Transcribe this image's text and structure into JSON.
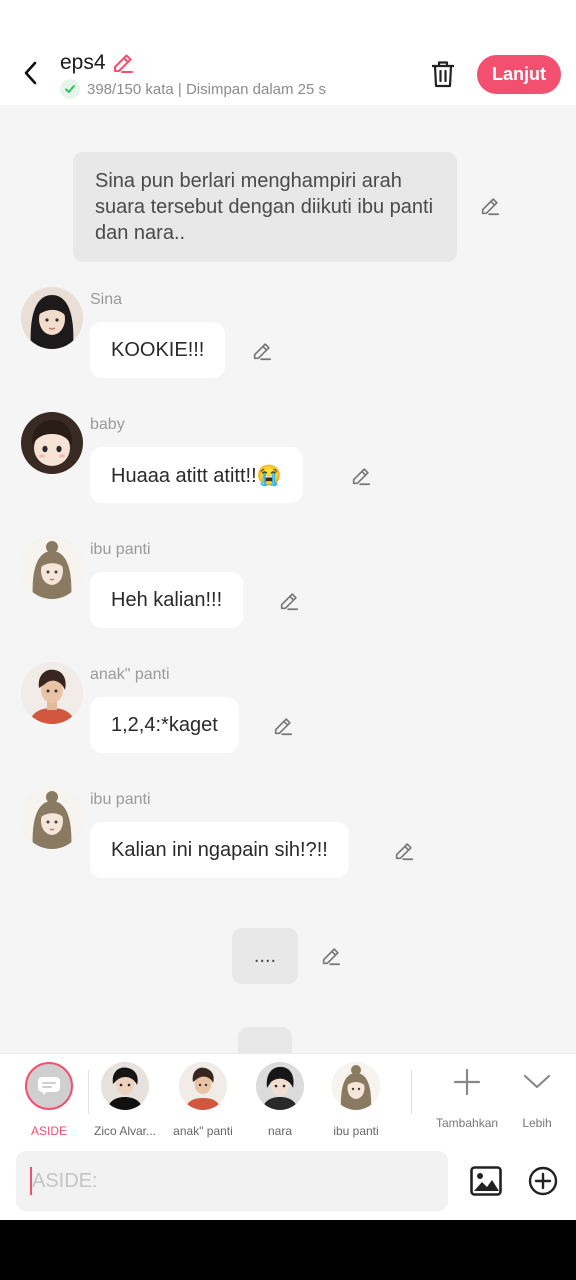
{
  "header": {
    "title": "eps4",
    "status": "398/150 kata | Disimpan dalam 25 s",
    "next_label": "Lanjut"
  },
  "chat": {
    "narration": "Sina pun berlari menghampiri arah suara tersebut dengan diikuti ibu panti dan nara..",
    "messages": [
      {
        "sender": "Sina",
        "text": "KOOKIE!!!"
      },
      {
        "sender": "baby",
        "text": "Huaaa atitt atitt!!😭"
      },
      {
        "sender": "ibu panti",
        "text": "Heh kalian!!!"
      },
      {
        "sender": "anak\" panti",
        "text": "1,2,4:*kaget"
      },
      {
        "sender": "ibu panti",
        "text": "Kalian ini ngapain sih!?!!"
      }
    ],
    "aside_text": "...."
  },
  "characters": [
    {
      "label": "ASIDE"
    },
    {
      "label": "Zico Alvar..."
    },
    {
      "label": "anak\" panti"
    },
    {
      "label": "nara"
    },
    {
      "label": "ibu panti"
    }
  ],
  "tools": {
    "add_label": "Tambahkan",
    "more_label": "Lebih"
  },
  "input": {
    "placeholder": "ASIDE:"
  },
  "colors": {
    "accent": "#f34f6e",
    "check": "#2fbf5b"
  },
  "icons": {
    "back": "chevron-left-icon",
    "title_edit": "pencil-icon",
    "saved": "check-icon",
    "delete": "trash-icon",
    "edit": "pencil-icon",
    "aside": "message-icon",
    "add": "plus-icon",
    "more": "chevron-down-icon",
    "image": "image-icon",
    "plus_circle": "plus-circle-icon"
  }
}
